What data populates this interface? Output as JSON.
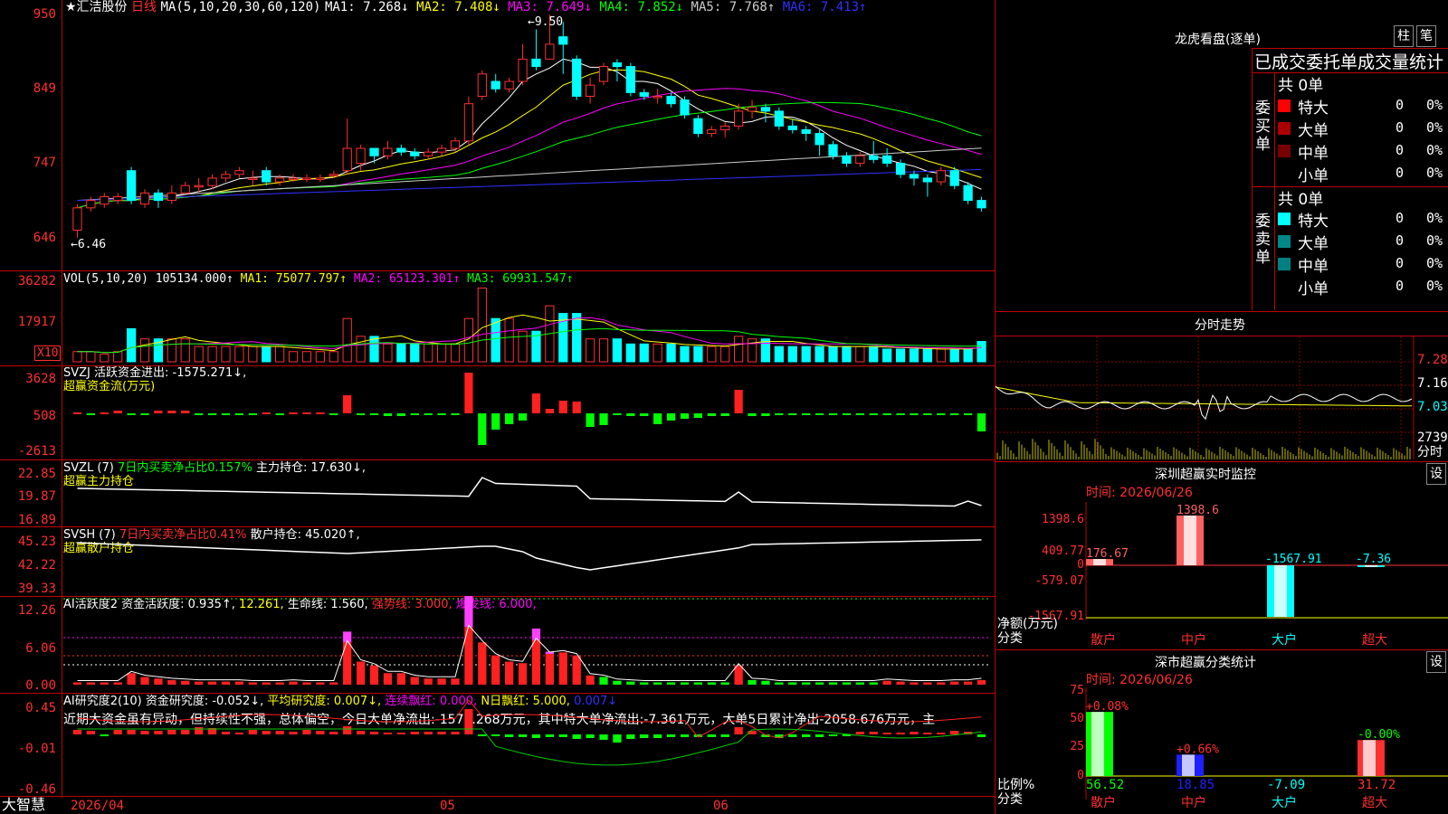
{
  "header": {
    "stock_name": "★汇洁股份",
    "period": "日线",
    "ma_label": "MA(5,10,20,30,60,120)",
    "ma_values": [
      {
        "text": "MA1: 7.268↓",
        "color": "#ffffff"
      },
      {
        "text": "MA2: 7.408↓",
        "color": "#ffff00"
      },
      {
        "text": "MA3: 7.649↓",
        "color": "#ff00ff"
      },
      {
        "text": "MA4: 7.852↓",
        "color": "#00ff00"
      },
      {
        "text": "MA5: 7.768↑",
        "color": "#cccccc"
      },
      {
        "text": "MA6: 7.413↑",
        "color": "#3030ff"
      }
    ]
  },
  "price_axis": [
    "950",
    "849",
    "747",
    "646"
  ],
  "price_marks": {
    "high": "9.50",
    "low": "6.46"
  },
  "vol": {
    "label": "VOL(5,10,20)",
    "value": "105134.000↑",
    "mas": [
      {
        "text": "MA1: 75077.797↑",
        "color": "#ffff00"
      },
      {
        "text": "MA2: 65123.301↑",
        "color": "#ff00ff"
      },
      {
        "text": "MA3: 69931.547↑",
        "color": "#00ff00"
      }
    ],
    "axis": [
      "36282",
      "17917"
    ],
    "unit": "X10"
  },
  "svzj": {
    "label": "SVZJ",
    "title": "活跃资金进出: -1575.271↓,",
    "sub": "超赢资金流(万元)",
    "axis": [
      "3628",
      "508",
      "-2613"
    ]
  },
  "svzl": {
    "label": "SVZL (7)",
    "pct": "7日内买卖净占比0.157%",
    "pos": "主力持仓: 17.630↓,",
    "sub": "超赢主力持仓",
    "axis": [
      "22.85",
      "19.87",
      "16.89"
    ]
  },
  "svsh": {
    "label": "SVSH (7)",
    "pct": "7日内买卖净占比0.41%",
    "pos": "散户持仓: 45.020↑,",
    "sub": "超赢散户持仓",
    "axis": [
      "45.23",
      "42.22",
      "39.33"
    ]
  },
  "ai1": {
    "label": "AI活跃度2",
    "t1": "资金活跃度: 0.935↑,",
    "t2": "12.261,",
    "t3": "生命线: 1.560,",
    "t4": "强势线: 3.000,",
    "t5": "爆发线: 6.000,",
    "axis": [
      "12.26",
      "6.06",
      "0.00"
    ]
  },
  "ai2": {
    "label": "AI研究度2(10)",
    "t1": "资金研究度: -0.052↓,",
    "t2": "平均研究度: 0.007↓,",
    "t3": "连续飘红: 0.000,",
    "t4": "N日飘红: 5.000,",
    "t5": "0.007↓",
    "axis": [
      "0.45",
      "-0.01",
      "-0.46"
    ],
    "comment": "近期大资金虽有异动，但持续性不强，总体偏空，今日大单净流出:-1575.268万元，其中特大单净流出:-7.361万元，大单5日累计净出-2058.676万元，主"
  },
  "footer": {
    "brand": "大智慧",
    "date": "2026/04",
    "m5": "05",
    "m6": "06"
  },
  "right": {
    "lhb_title": "龙虎看盘(逐单)",
    "btn_zhu": "柱",
    "btn_bi": "笔",
    "stat_title": "已成交委托单成交量统计",
    "buy_side": "委买单",
    "sell_side": "委卖单",
    "buy_total": "共 0单",
    "sell_total": "共 0单",
    "buy_rows": [
      {
        "name": "特大",
        "v": "0",
        "p": "0%",
        "c": "#ff0000"
      },
      {
        "name": "大单",
        "v": "0",
        "p": "0%",
        "c": "#aa0000"
      },
      {
        "name": "中单",
        "v": "0",
        "p": "0%",
        "c": "#770000"
      },
      {
        "name": "小单",
        "v": "0",
        "p": "0%",
        "c": ""
      }
    ],
    "sell_rows": [
      {
        "name": "特大",
        "v": "0",
        "p": "0%",
        "c": "#00ffff"
      },
      {
        "name": "大单",
        "v": "0",
        "p": "0%",
        "c": "#008888"
      },
      {
        "name": "中单",
        "v": "0",
        "p": "0%",
        "c": "#008080"
      },
      {
        "name": "小单",
        "v": "0",
        "p": "0%",
        "c": ""
      }
    ],
    "fs_title": "分时走势",
    "fs_axis": [
      "7.28",
      "7.16",
      "7.03",
      "2739"
    ],
    "fs_unit": "分时",
    "sz_title": "深圳超赢实时监控",
    "sz_btn": "设",
    "sz_time": "时间: 2026/06/26",
    "sz_axis": [
      "1398.6",
      "409.77",
      "0",
      "-579.07",
      "-1567.91"
    ],
    "sz_ylabel": "净额(万元)",
    "sz_xlabel": "分类",
    "cats": [
      "散户",
      "中户",
      "大户",
      "超大"
    ],
    "sz_bars": [
      {
        "cat": "散户",
        "value": 176.67,
        "label": "176.67"
      },
      {
        "cat": "中户",
        "value": 1398.6,
        "label": "1398.6"
      },
      {
        "cat": "大户",
        "value": -1567.91,
        "label": "-1567.91"
      },
      {
        "cat": "超大",
        "value": -7.36,
        "label": "-7.36"
      }
    ],
    "ss_title": "深市超赢分类统计",
    "ss_btn": "设",
    "ss_time": "时间: 2026/06/26",
    "ss_axis": [
      "75",
      "50",
      "25",
      "0"
    ],
    "ss_ylabel": "比例%",
    "ss_xlabel": "分类",
    "ss_bars": [
      {
        "cat": "散户",
        "value": 56.52,
        "label": "56.52",
        "delta": "+0.08%"
      },
      {
        "cat": "中户",
        "value": 18.85,
        "label": "18.85",
        "delta": "+0.66%"
      },
      {
        "cat": "大户",
        "value": -7.09,
        "label": "-7.09",
        "delta": ""
      },
      {
        "cat": "超大",
        "value": 31.72,
        "label": "31.72",
        "delta": "-0.00%"
      }
    ]
  },
  "chart_data": [
    {
      "type": "candlestick",
      "title": "★汇洁股份 日线",
      "ylim": [
        6.46,
        9.5
      ],
      "y_ticks": [
        9.5,
        8.49,
        7.47,
        6.46
      ],
      "high_label": "9.50",
      "low_label": "6.46",
      "candles": [
        [
          6.6,
          6.9,
          6.5,
          6.95
        ],
        [
          6.9,
          7.0,
          6.85,
          7.05
        ],
        [
          6.95,
          7.05,
          6.9,
          7.1
        ],
        [
          7.0,
          7.05,
          6.95,
          7.1
        ],
        [
          7.4,
          7.0,
          6.95,
          7.45
        ],
        [
          6.95,
          7.1,
          6.9,
          7.15
        ],
        [
          7.1,
          7.0,
          6.9,
          7.15
        ],
        [
          7.0,
          7.1,
          6.95,
          7.2
        ],
        [
          7.1,
          7.2,
          7.1,
          7.25
        ],
        [
          7.2,
          7.2,
          7.1,
          7.3
        ],
        [
          7.2,
          7.3,
          7.15,
          7.35
        ],
        [
          7.3,
          7.35,
          7.25,
          7.4
        ],
        [
          7.35,
          7.4,
          7.3,
          7.45
        ],
        [
          7.3,
          7.3,
          7.2,
          7.4
        ],
        [
          7.4,
          7.25,
          7.2,
          7.45
        ],
        [
          7.25,
          7.3,
          7.2,
          7.35
        ],
        [
          7.3,
          7.3,
          7.25,
          7.35
        ],
        [
          7.3,
          7.3,
          7.25,
          7.35
        ],
        [
          7.3,
          7.3,
          7.25,
          7.35
        ],
        [
          7.35,
          7.35,
          7.3,
          7.4
        ],
        [
          7.4,
          7.7,
          7.35,
          8.1
        ],
        [
          7.5,
          7.7,
          7.4,
          7.75
        ],
        [
          7.7,
          7.6,
          7.5,
          7.7
        ],
        [
          7.6,
          7.7,
          7.55,
          7.8
        ],
        [
          7.7,
          7.65,
          7.6,
          7.75
        ],
        [
          7.65,
          7.6,
          7.55,
          7.7
        ],
        [
          7.6,
          7.65,
          7.55,
          7.7
        ],
        [
          7.65,
          7.7,
          7.6,
          7.75
        ],
        [
          7.7,
          7.8,
          7.65,
          7.85
        ],
        [
          7.8,
          8.3,
          7.75,
          8.4
        ],
        [
          8.4,
          8.7,
          8.35,
          8.75
        ],
        [
          8.6,
          8.5,
          8.45,
          8.7
        ],
        [
          8.5,
          8.6,
          8.45,
          8.65
        ],
        [
          8.6,
          8.9,
          8.55,
          9.1
        ],
        [
          8.9,
          8.8,
          8.75,
          9.3
        ],
        [
          8.9,
          9.1,
          8.9,
          9.5
        ],
        [
          9.2,
          9.1,
          8.7,
          9.4
        ],
        [
          8.9,
          8.4,
          8.35,
          8.95
        ],
        [
          8.4,
          8.55,
          8.3,
          8.65
        ],
        [
          8.6,
          8.8,
          8.55,
          8.85
        ],
        [
          8.85,
          8.8,
          8.6,
          8.9
        ],
        [
          8.8,
          8.45,
          8.4,
          8.85
        ],
        [
          8.45,
          8.4,
          8.35,
          8.5
        ],
        [
          8.4,
          8.4,
          8.3,
          8.5
        ],
        [
          8.4,
          8.3,
          8.25,
          8.45
        ],
        [
          8.35,
          8.15,
          8.1,
          8.4
        ],
        [
          8.1,
          7.9,
          7.85,
          8.15
        ],
        [
          7.9,
          7.95,
          7.85,
          8.0
        ],
        [
          7.95,
          8.0,
          7.85,
          8.05
        ],
        [
          8.0,
          8.2,
          7.95,
          8.3
        ],
        [
          8.2,
          8.25,
          8.1,
          8.35
        ],
        [
          8.25,
          8.2,
          8.05,
          8.3
        ],
        [
          8.2,
          8.0,
          7.95,
          8.25
        ],
        [
          8.0,
          7.95,
          7.9,
          8.1
        ],
        [
          7.95,
          7.9,
          7.8,
          8.0
        ],
        [
          7.9,
          7.75,
          7.6,
          7.95
        ],
        [
          7.75,
          7.6,
          7.55,
          7.8
        ],
        [
          7.6,
          7.5,
          7.45,
          7.65
        ],
        [
          7.5,
          7.6,
          7.45,
          7.65
        ],
        [
          7.6,
          7.55,
          7.5,
          7.8
        ],
        [
          7.6,
          7.5,
          7.45,
          7.7
        ],
        [
          7.5,
          7.35,
          7.3,
          7.55
        ],
        [
          7.35,
          7.3,
          7.2,
          7.4
        ],
        [
          7.3,
          7.25,
          7.05,
          7.35
        ],
        [
          7.25,
          7.4,
          7.2,
          7.45
        ],
        [
          7.4,
          7.2,
          7.15,
          7.45
        ],
        [
          7.2,
          7.0,
          6.95,
          7.25
        ],
        [
          7.0,
          6.9,
          6.85,
          7.05
        ]
      ]
    },
    {
      "type": "bar",
      "title": "VOL(5,10,20)",
      "values": [
        4,
        4,
        3,
        4,
        13,
        9,
        9,
        9,
        9,
        6,
        6,
        6,
        6,
        6,
        6,
        6,
        4,
        4,
        4,
        4,
        17,
        10,
        10,
        7,
        7,
        7,
        7,
        7,
        7,
        17,
        29,
        17,
        17,
        12,
        12,
        22,
        19,
        19,
        9,
        9,
        9,
        7,
        7,
        7,
        7,
        6,
        6,
        6,
        6,
        10,
        9,
        9,
        6,
        6,
        6,
        6,
        6,
        6,
        6,
        6,
        5,
        5,
        5,
        5,
        5,
        5,
        5,
        8
      ],
      "unit": "X10"
    },
    {
      "type": "bar",
      "title": "SVZJ 超赢资金流(万元)",
      "ylim": [
        -2613,
        3628
      ]
    },
    {
      "type": "line",
      "title": "SVZL 超赢主力持仓",
      "ylim": [
        16.89,
        22.85
      ]
    },
    {
      "type": "line",
      "title": "SVSH 超赢散户持仓",
      "ylim": [
        39.33,
        45.23
      ]
    },
    {
      "type": "bar",
      "title": "AI活跃度2",
      "ylim": [
        0,
        12.26
      ]
    },
    {
      "type": "bar",
      "title": "AI研究度2(10)",
      "ylim": [
        -0.46,
        0.45
      ]
    },
    {
      "type": "bar",
      "title": "深圳超赢实时监控",
      "categories": [
        "散户",
        "中户",
        "大户",
        "超大"
      ],
      "values": [
        176.67,
        1398.6,
        -1567.91,
        -7.36
      ],
      "ylim": [
        -1567.91,
        1398.6
      ],
      "ylabel": "净额(万元)",
      "xlabel": "分类"
    },
    {
      "type": "bar",
      "title": "深市超赢分类统计",
      "categories": [
        "散户",
        "中户",
        "大户",
        "超大"
      ],
      "values": [
        56.52,
        18.85,
        -7.09,
        31.72
      ],
      "ylim": [
        0,
        75
      ],
      "ylabel": "比例%",
      "xlabel": "分类"
    }
  ]
}
